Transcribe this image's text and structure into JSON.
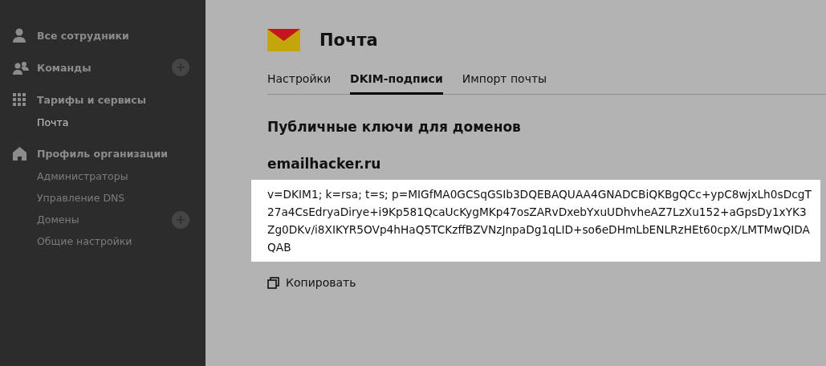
{
  "sidebar": {
    "sections": [
      {
        "label": "Все сотрудники",
        "can_add": false
      },
      {
        "label": "Команды",
        "can_add": true
      },
      {
        "label": "Тарифы и сервисы",
        "can_add": false,
        "items": [
          {
            "label": "Почта",
            "selected": true,
            "can_add": false
          }
        ]
      },
      {
        "label": "Профиль организации",
        "can_add": false,
        "items": [
          {
            "label": "Администраторы",
            "selected": false,
            "can_add": false
          },
          {
            "label": "Управление DNS",
            "selected": false,
            "can_add": false
          },
          {
            "label": "Домены",
            "selected": false,
            "can_add": true
          },
          {
            "label": "Общие настройки",
            "selected": false,
            "can_add": false
          }
        ]
      }
    ]
  },
  "page": {
    "title": "Почта",
    "tabs": [
      {
        "label": "Настройки",
        "selected": false
      },
      {
        "label": "DKIM-подписи",
        "selected": true
      },
      {
        "label": "Импорт почты",
        "selected": false
      }
    ],
    "heading": "Публичные ключи для доменов",
    "domain": "emailhacker.ru",
    "key": "v=DKIM1; k=rsa; t=s; p=MIGfMA0GCSqGSIb3DQEBAQUAA4GNADCBiQKBgQCc+ypC8wjxLh0sDcgT27a4CsEdryaDirye+i9Kp581QcaUcKygMKp47osZARvDxebYxuUDhvheAZ7LzXu152+aGpsDy1xYK3Zg0DKv/i8XIKYR5OVp4hHaQ5TCKzffBZVNzJnpaDg1qLID+so6eDHmLbENLRzHEt60cpX/LMTMwQIDAQAB",
    "copy_label": "Копировать"
  }
}
